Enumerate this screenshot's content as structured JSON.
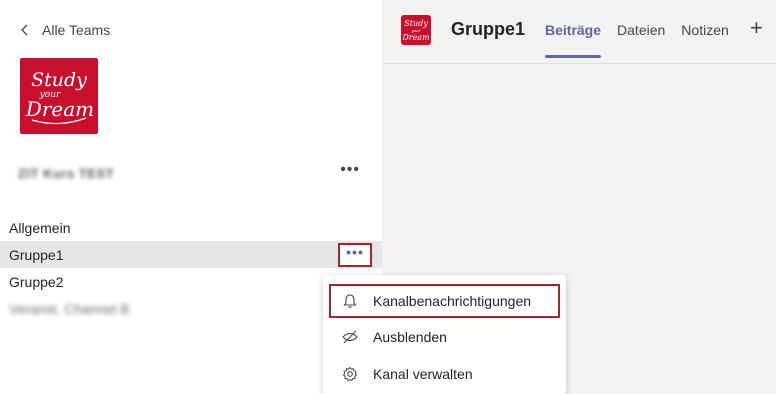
{
  "sidebar": {
    "back_label": "Alle Teams",
    "team_name": "ZIT Kurs TEST",
    "channels": [
      {
        "label": "Allgemein"
      },
      {
        "label": "Gruppe1"
      },
      {
        "label": "Gruppe2"
      },
      {
        "label": "Veranst. Channel  B"
      }
    ],
    "more_label": "•••",
    "team_more_label": "•••"
  },
  "header": {
    "channel_title": "Gruppe1",
    "tabs": [
      {
        "label": "Beiträge"
      },
      {
        "label": "Dateien"
      },
      {
        "label": "Notizen"
      }
    ],
    "add_label": "+"
  },
  "context_menu": {
    "items": [
      {
        "label": "Kanalbenachrichtigungen",
        "icon": "bell-icon"
      },
      {
        "label": "Ausblenden",
        "icon": "eye-off-icon"
      },
      {
        "label": "Kanal verwalten",
        "icon": "gear-icon"
      }
    ]
  },
  "colors": {
    "brand": "#c8102e",
    "accent": "#6264a7",
    "highlight_border": "#a4262c"
  }
}
